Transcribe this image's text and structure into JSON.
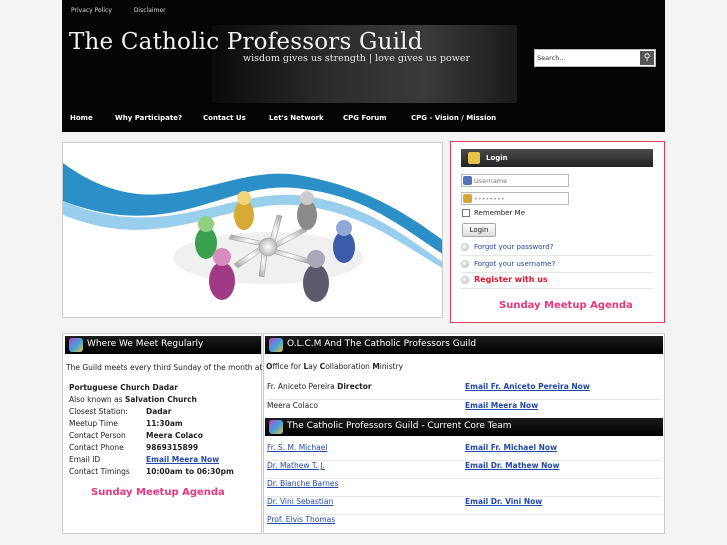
{
  "header": {
    "top_links": [
      "Privacy Policy",
      "Disclaimer"
    ],
    "site_title": "The Catholic Professors Guild",
    "tagline": "wisdom gives us strength | love gives us power",
    "search_placeholder": "Search...",
    "nav": [
      "Home",
      "Why Participate?",
      "Contact Us",
      "Let's Network",
      "CPG Forum",
      "CPG - Vision / Mission"
    ]
  },
  "login": {
    "title": "Login",
    "username_placeholder": "Username",
    "password_value": "••••••••",
    "remember_label": "Remember Me",
    "button_label": "Login",
    "forgot_password": "Forgot your password?",
    "forgot_username": "Forgot your username?",
    "register": "Register with us",
    "agenda": "Sunday Meetup Agenda"
  },
  "where": {
    "title": "Where We Meet Regularly",
    "intro": "The Guild meets every third Sunday of the month at:",
    "venue": "Portuguese Church Dadar",
    "aka_prefix": "Also known as ",
    "aka_name": "Salvation Church",
    "details": [
      {
        "k": "Closest Station:",
        "v": "Dadar"
      },
      {
        "k": "Meetup Time",
        "v": "11:30am"
      },
      {
        "k": "Contact Person",
        "v": "Meera Colaco"
      },
      {
        "k": "Contact Phone",
        "v": "9869315899"
      },
      {
        "k": "Email ID",
        "v": "Email Meera Now"
      },
      {
        "k": "Contact Timings",
        "v": "10:00am to 06:30pm"
      }
    ],
    "agenda": "Sunday Meetup Agenda"
  },
  "olcm": {
    "title": "O.L.C.M And The Catholic Professors Guild",
    "subtitle_parts": [
      "O",
      "ffice for ",
      "L",
      "ay ",
      "C",
      "ollaboration ",
      "M",
      "inistry"
    ],
    "contacts": [
      {
        "name": "Fr. Aniceto Pereira",
        "role": "Director",
        "email": "Email Fr. Aniceto Pereira Now"
      },
      {
        "name": "Meera Colaco",
        "role": "",
        "email": "Email Meera Now"
      }
    ]
  },
  "core_team": {
    "title": "The Catholic Professors Guild - Current Core Team",
    "members": [
      {
        "name": "Fr. S. M. Michael",
        "email": "Email Fr. Michael Now"
      },
      {
        "name": "Dr. Mathew T. J.",
        "email": "Email Dr. Mathew Now"
      },
      {
        "name": "Dr. Blanche Barnes",
        "email": ""
      },
      {
        "name": "Dr. Vini Sebastian",
        "email": "Email Dr. Vini Now"
      },
      {
        "name": "Prof. Elvis Thomas",
        "email": ""
      }
    ]
  },
  "colors": {
    "header_bg": "#050505",
    "link": "#2248a8",
    "register": "#e0142c",
    "agenda": "#e8367c",
    "login_border": "#e03a5a"
  },
  "icons": [
    "search-icon",
    "login-icon",
    "user-icon",
    "key-icon",
    "people-icon"
  ]
}
